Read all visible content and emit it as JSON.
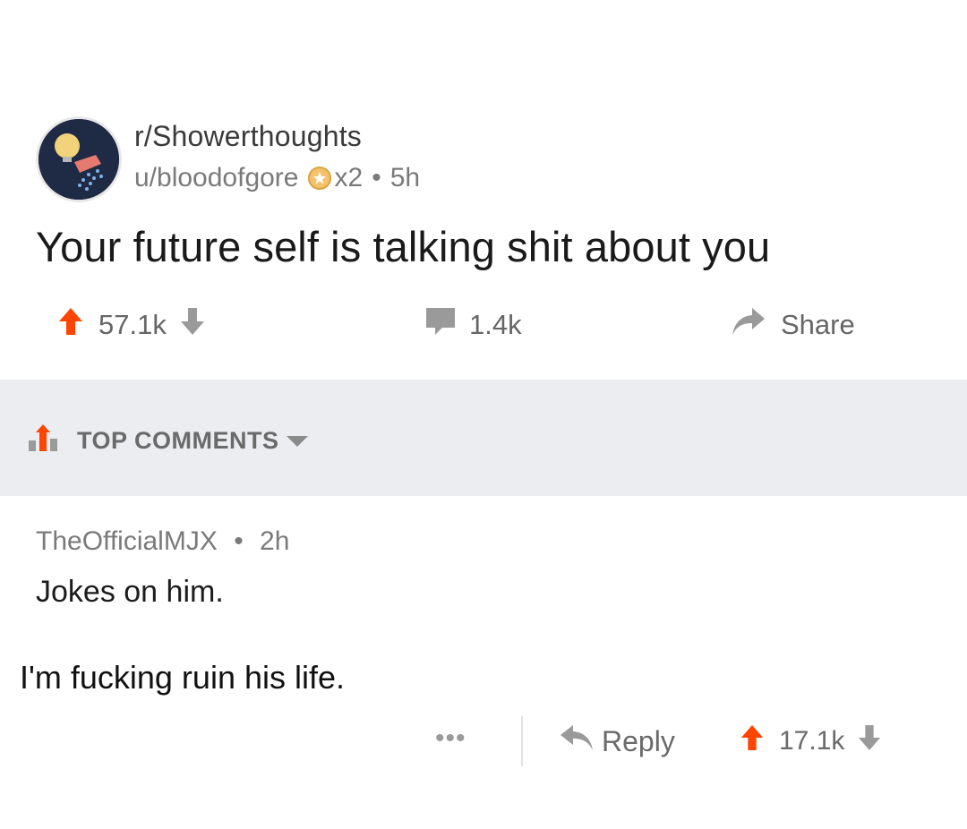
{
  "post": {
    "subreddit": "r/Showerthoughts",
    "author": "u/bloodofgore",
    "award_count": "x2",
    "separator": "•",
    "age": "5h",
    "title": "Your future self is talking shit about you",
    "upvotes": "57.1k",
    "comments": "1.4k",
    "share_label": "Share"
  },
  "comments_header": {
    "label": "TOP COMMENTS"
  },
  "comment": {
    "author": "TheOfficialMJX",
    "separator": "•",
    "age": "2h",
    "line1": "Jokes on him.",
    "line2": "I'm fucking ruin his life.",
    "more_label": "•••",
    "reply_label": "Reply",
    "upvotes": "17.1k"
  },
  "colors": {
    "upvote": "#ff4500",
    "icon_gray": "#9a9a9a",
    "band": "#ebedf0"
  }
}
